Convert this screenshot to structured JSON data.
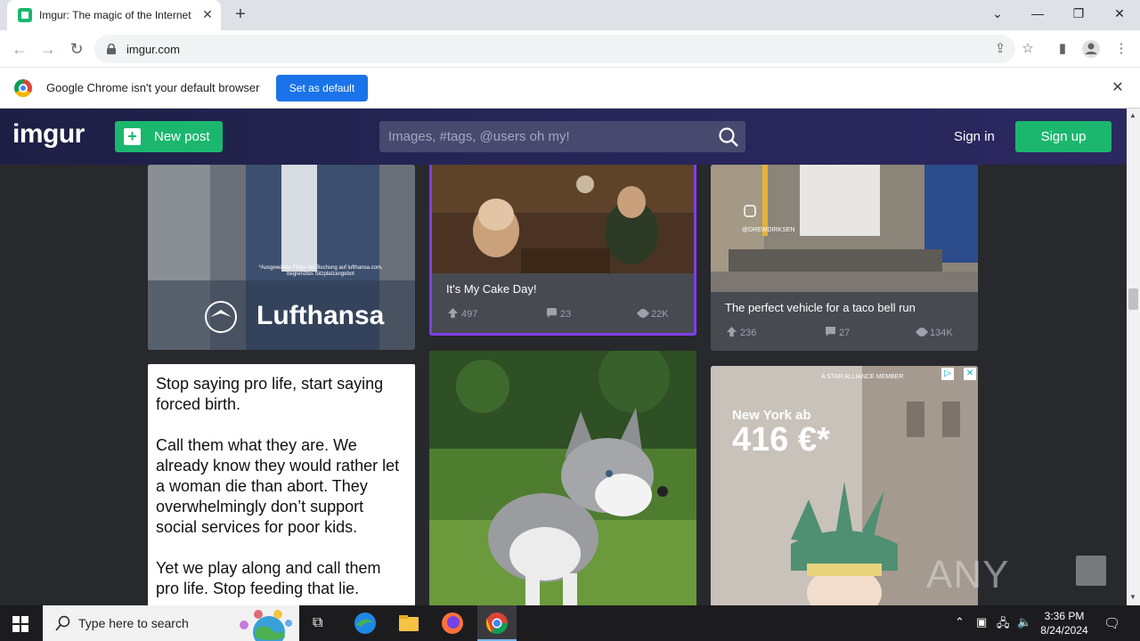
{
  "browser": {
    "tab_title": "Imgur: The magic of the Internet",
    "url": "imgur.com",
    "infobar_message": "Google Chrome isn't your default browser",
    "infobar_button": "Set as default"
  },
  "header": {
    "logo": "imgur",
    "new_post": "New post",
    "search_placeholder": "Images, #tags, @users oh my!",
    "sign_in": "Sign in",
    "sign_up": "Sign up"
  },
  "posts": [
    {
      "caption": "Lufthansa",
      "fine_print": "*Ausgewählte Flüge bei Buchung auf lufthansa.com, begrenztes Sitzplatzangebot"
    },
    {
      "caption": "It's My Cake Day!",
      "upvotes": "497",
      "comments": "23",
      "views": "22K"
    },
    {
      "caption": "The perfect vehicle for a taco bell run",
      "watermark": "@DREWDIRKSEN",
      "upvotes": "236",
      "comments": "27",
      "views": "134K"
    },
    {
      "text": "Stop saying pro life, start saying forced birth.\n\nCall them what they are. We already know they would rather let a woman die than abort. They overwhelmingly don’t support social services for poor kids.\n\nYet we play along and call them pro life. Stop feeding that lie."
    },
    {
      "caption": "husky puppy"
    },
    {
      "ad_alliance": "A STAR ALLIANCE MEMBER",
      "ad_headline": "New York ab",
      "ad_price": "416 €*"
    }
  ],
  "watermark": "ANY RUN",
  "taskbar": {
    "search_text": "Type here to search",
    "time": "3:36 PM",
    "date": "8/24/2024"
  }
}
